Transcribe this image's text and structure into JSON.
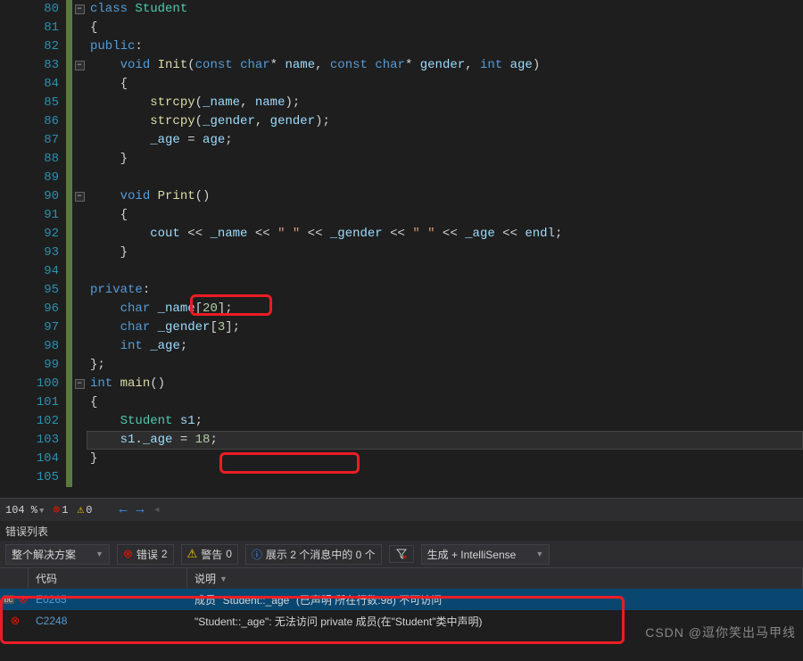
{
  "lines": {
    "80": 80,
    "81": 81,
    "82": 82,
    "83": 83,
    "84": 84,
    "85": 85,
    "86": 86,
    "87": 87,
    "88": 88,
    "89": 89,
    "90": 90,
    "91": 91,
    "92": 92,
    "93": 93,
    "94": 94,
    "95": 95,
    "96": 96,
    "97": 97,
    "98": 98,
    "99": 99,
    "100": 100,
    "101": 101,
    "102": 102,
    "103": 103,
    "104": 104,
    "105": 105
  },
  "code": {
    "l80": {
      "a": "class",
      "b": " ",
      "c": "Student"
    },
    "l81": "{",
    "l82": {
      "a": "public",
      "b": ":"
    },
    "l83": {
      "a": "    ",
      "b": "void",
      "c": " ",
      "d": "Init",
      "e": "(",
      "f": "const",
      "g": " ",
      "h": "char",
      "i": "* ",
      "j": "name",
      "k": ", ",
      "l": "const",
      "m": " ",
      "n": "char",
      "o": "* ",
      "p": "gender",
      "q": ", ",
      "r": "int",
      "s": " ",
      "t": "age",
      "u": ")"
    },
    "l84": "    {",
    "l85": {
      "a": "        ",
      "b": "strcpy",
      "c": "(",
      "d": "_name",
      "e": ", ",
      "f": "name",
      "g": ");"
    },
    "l86": {
      "a": "        ",
      "b": "strcpy",
      "c": "(",
      "d": "_gender",
      "e": ", ",
      "f": "gender",
      "g": ");"
    },
    "l87": {
      "a": "        ",
      "b": "_age",
      "c": " = ",
      "d": "age",
      "e": ";"
    },
    "l88": "    }",
    "l90": {
      "a": "    ",
      "b": "void",
      "c": " ",
      "d": "Print",
      "e": "()"
    },
    "l91": "    {",
    "l92": {
      "a": "        ",
      "b": "cout",
      "c": " << ",
      "d": "_name",
      "e": " << ",
      "f": "\" \"",
      "g": " << ",
      "h": "_gender",
      "i": " << ",
      "j": "\" \"",
      "k": " << ",
      "l": "_age",
      "m": " << ",
      "n": "endl",
      "o": ";"
    },
    "l93": "    }",
    "l95": {
      "a": "private",
      "b": ":"
    },
    "l96": {
      "a": "    ",
      "b": "char",
      "c": " ",
      "d": "_name",
      "e": "[",
      "f": "20",
      "g": "];"
    },
    "l97": {
      "a": "    ",
      "b": "char",
      "c": " ",
      "d": "_gender",
      "e": "[",
      "f": "3",
      "g": "];"
    },
    "l98": {
      "a": "    ",
      "b": "int",
      "c": " ",
      "d": "_age",
      "e": ";"
    },
    "l99": "};",
    "l100": {
      "a": "int",
      "b": " ",
      "c": "main",
      "d": "()"
    },
    "l101": "{",
    "l102": {
      "a": "    ",
      "b": "Student",
      "c": " ",
      "d": "s1",
      "e": ";"
    },
    "l103": {
      "a": "    ",
      "b": "s1",
      "c": ".",
      "d": "_age",
      "e": " = ",
      "f": "18",
      "g": ";"
    },
    "l104": "}"
  },
  "quickbar": {
    "zoom": "104 %",
    "err_count": "1",
    "warn_count": "0"
  },
  "panel": {
    "title": "错误列表"
  },
  "toolbar": {
    "scope": "整个解决方案",
    "errors_label": "错误",
    "errors_count": "2",
    "warnings_label": "警告",
    "warnings_count": "0",
    "info_text": "展示 2 个消息中的 0 个",
    "source": "生成 + IntelliSense"
  },
  "table": {
    "col_code": "代码",
    "col_desc": "说明"
  },
  "errors": [
    {
      "code": "E0265",
      "desc": "成员 \"Student::_age\" (已声明 所在行数:98) 不可访问"
    },
    {
      "code": "C2248",
      "desc": "\"Student::_age\": 无法访问 private 成员(在\"Student\"类中声明)"
    }
  ],
  "watermark": {
    "a": "CSDN",
    "b": " @逗你笑出马甲线"
  }
}
